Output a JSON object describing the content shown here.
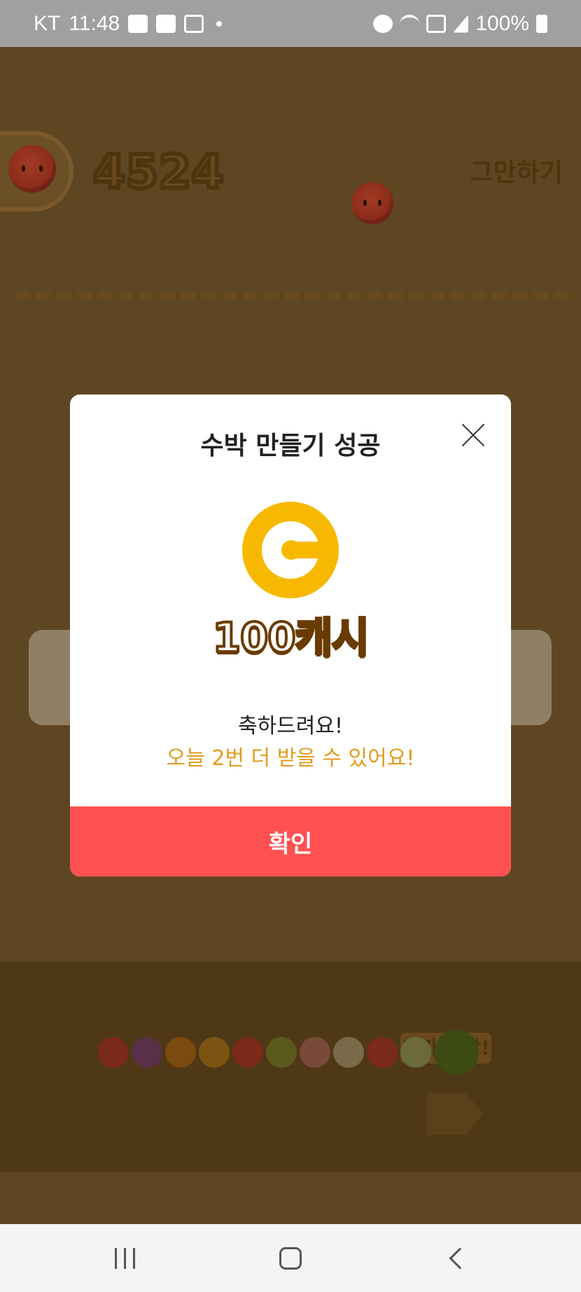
{
  "status_bar": {
    "carrier": "KT",
    "time": "11:48",
    "battery": "100%",
    "icons": [
      "message-icon",
      "gallery-icon",
      "feather-icon",
      "alarm-icon",
      "wifi-icon",
      "hd-icon",
      "signal-icon",
      "battery-icon"
    ]
  },
  "game": {
    "score": "4524",
    "stop_label": "그만하기",
    "evolution_label": "내가 수박!",
    "evolution_chain": [
      "strawberry",
      "grape",
      "orange",
      "persimmon",
      "apple",
      "kiwi",
      "peach",
      "pineapple",
      "tomato",
      "melon",
      "watermelon"
    ]
  },
  "modal": {
    "title": "수박 만들기 성공",
    "reward": "100캐시",
    "congrats": "축하드려요!",
    "sub_message": "오늘 2번 더 받을 수 있어요!",
    "confirm_label": "확인",
    "coin_color": "#f7b900",
    "button_color": "#ff5151",
    "accent_text_color": "#e29a1e"
  },
  "nav_bar": {
    "buttons": [
      "recent-apps",
      "home",
      "back"
    ]
  }
}
